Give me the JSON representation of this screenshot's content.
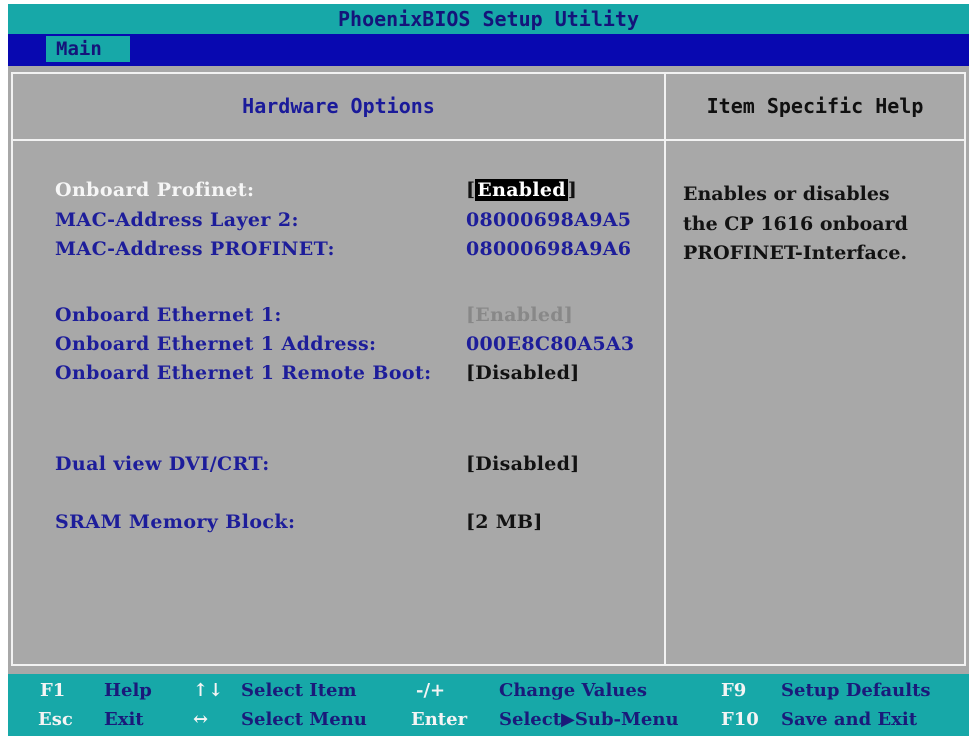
{
  "title": "PhoenixBIOS Setup Utility",
  "menu": {
    "active_tab": "Main"
  },
  "panel": {
    "title": "Hardware Options",
    "help_title": "Item Specific Help",
    "open_bracket": "[",
    "close_bracket": "]",
    "items": [
      {
        "label": "Onboard Profinet:",
        "value": "Enabled",
        "selected": true
      },
      {
        "label": "MAC-Address Layer 2:",
        "value": "08000698A9A5"
      },
      {
        "label": "MAC-Address PROFINET:",
        "value": "08000698A9A6"
      },
      {
        "label": "Onboard Ethernet 1:",
        "value": "[Enabled]"
      },
      {
        "label": "Onboard Ethernet 1 Address:",
        "value": "000E8C80A5A3"
      },
      {
        "label": "Onboard Ethernet 1 Remote Boot:",
        "value": "[Disabled]"
      },
      {
        "label": "Dual view DVI/CRT:",
        "value": "[Disabled]"
      },
      {
        "label": "SRAM Memory Block:",
        "value": "[2 MB]"
      }
    ]
  },
  "help": {
    "lines": [
      "Enables or disables",
      "the CP 1616 onboard",
      "PROFINET-Interface."
    ]
  },
  "footer": {
    "row1": [
      {
        "key": "F1",
        "desc": "Help"
      },
      {
        "key": "↑↓",
        "desc": "Select Item"
      },
      {
        "key": "-/+",
        "desc": "Change Values"
      },
      {
        "key": "F9",
        "desc": "Setup Defaults"
      }
    ],
    "row2": [
      {
        "key": "Esc",
        "desc": "Exit"
      },
      {
        "key": "↔",
        "desc": "Select Menu"
      },
      {
        "key": "Enter",
        "desc": "Select▶Sub-Menu"
      },
      {
        "key": "F10",
        "desc": "Save and Exit"
      }
    ]
  },
  "colors": {
    "background": "#a8a8a8",
    "title_bar": "#17a8a8",
    "menu_bar": "#0808b0",
    "label_text": "#1d1d9a",
    "selected_label": "#f6f6f6",
    "selected_value_bg": "#000000"
  }
}
